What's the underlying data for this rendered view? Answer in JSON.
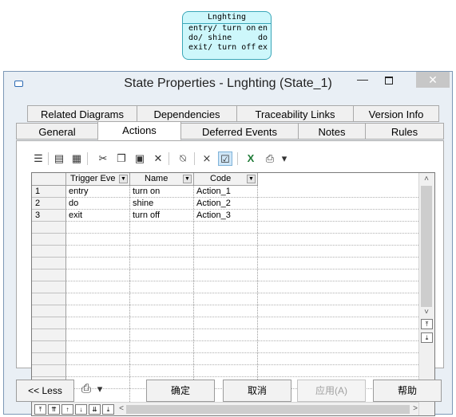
{
  "state_node": {
    "title": "Lnghting",
    "rows": [
      {
        "left": "entry/ turn on",
        "right": "en"
      },
      {
        "left": "do/ shine",
        "right": "do"
      },
      {
        "left": "exit/ turn off",
        "right": "ex"
      }
    ]
  },
  "window": {
    "title": "State Properties - Lnghting (State_1)",
    "min_glyph": "—",
    "close_glyph": "✕"
  },
  "tabs": {
    "row1": [
      "Related Diagrams",
      "Dependencies",
      "Traceability Links",
      "Version Info"
    ],
    "row2": [
      "General",
      "Actions",
      "Deferred Events",
      "Notes",
      "Rules"
    ],
    "active": "Actions"
  },
  "toolbar": {
    "icons": [
      "properties-icon",
      "insert-row-icon",
      "add-row-icon",
      "cut-icon",
      "copy-icon",
      "paste-icon",
      "delete-icon",
      "find-icon",
      "filter-icon",
      "customize-columns-icon",
      "excel-icon",
      "print-icon",
      "print-dropdown-icon"
    ],
    "glyphs": [
      "☰",
      "▤",
      "▦",
      "✂",
      "❐",
      "▣",
      "✕",
      "⍉",
      "⨯",
      "☑",
      "X",
      "⎙",
      "▾"
    ]
  },
  "grid": {
    "columns": [
      "Trigger Eve",
      "Name",
      "Code"
    ],
    "rows": [
      {
        "num": "1",
        "trigger": "entry",
        "name": "turn on",
        "code": "Action_1"
      },
      {
        "num": "2",
        "trigger": "do",
        "name": "shine",
        "code": "Action_2"
      },
      {
        "num": "3",
        "trigger": "exit",
        "name": "turn off",
        "code": "Action_3"
      }
    ],
    "nav_glyphs": [
      "⤒",
      "⇈",
      "↑",
      "↓",
      "⇊",
      "⤓"
    ],
    "scroll_glyphs": {
      "up": "˄",
      "down": "˅",
      "left": "<",
      "right": ">"
    }
  },
  "buttons": {
    "less": "<< Less",
    "ok": "确定",
    "cancel": "取消",
    "apply": "应用(A)",
    "help": "帮助",
    "report_icon": "⎙",
    "report_dropdown": "▾"
  }
}
